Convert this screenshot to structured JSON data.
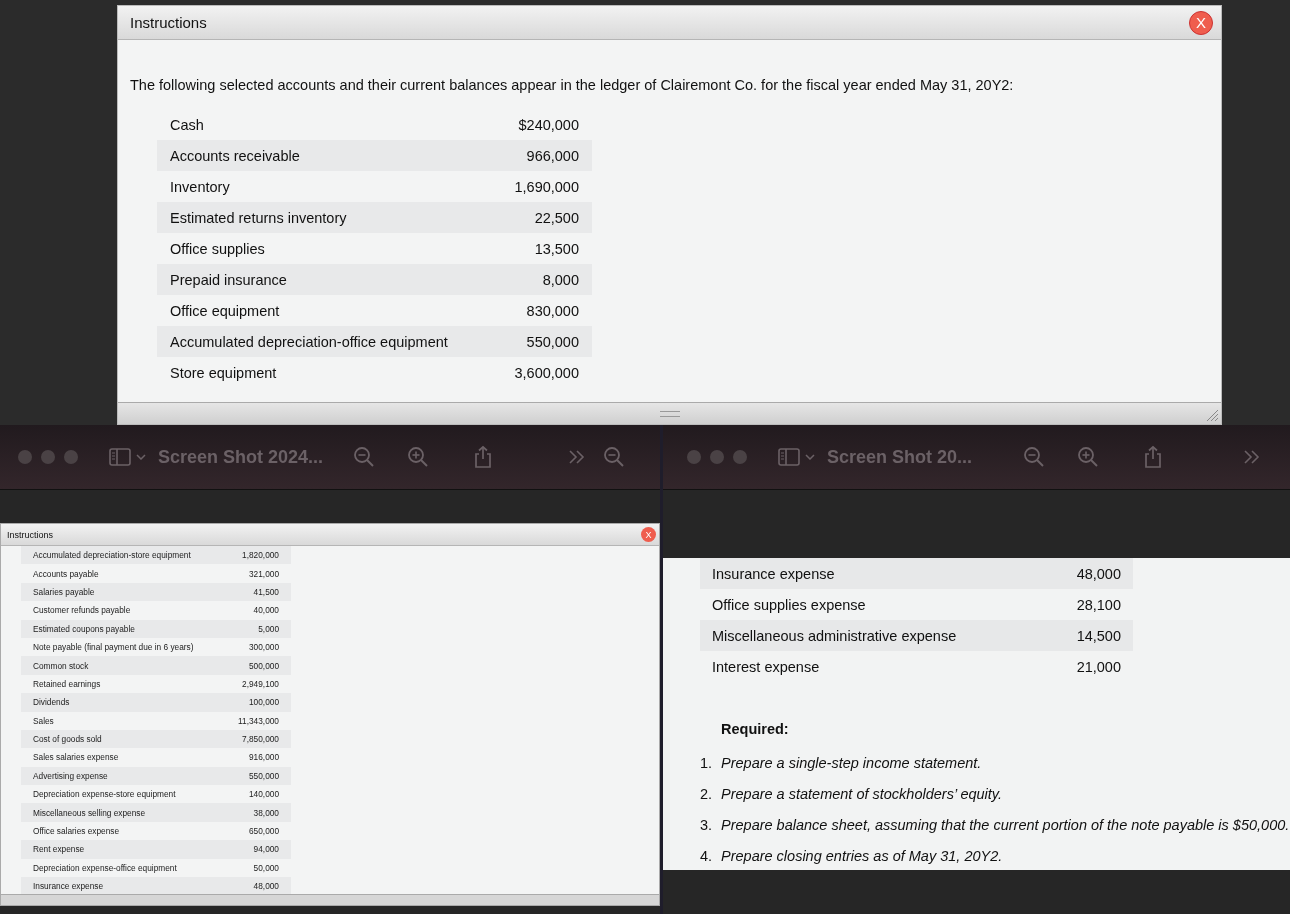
{
  "dialog": {
    "title": "Instructions",
    "close": "X",
    "intro": "The following selected accounts and their current balances appear in the ledger of Clairemont Co. for the fiscal year ended May 31, 20Y2:",
    "accounts": [
      {
        "name": "Cash",
        "amount": "$240,000"
      },
      {
        "name": "Accounts receivable",
        "amount": "966,000"
      },
      {
        "name": "Inventory",
        "amount": "1,690,000"
      },
      {
        "name": "Estimated returns inventory",
        "amount": "22,500"
      },
      {
        "name": "Office supplies",
        "amount": "13,500"
      },
      {
        "name": "Prepaid insurance",
        "amount": "8,000"
      },
      {
        "name": "Office equipment",
        "amount": "830,000"
      },
      {
        "name": "Accumulated depreciation-office equipment",
        "amount": "550,000"
      },
      {
        "name": "Store equipment",
        "amount": "3,600,000"
      }
    ]
  },
  "viewer_windows": [
    {
      "title": "Screen Shot 2024...",
      "dialog": {
        "title": "Instructions",
        "close": "X",
        "accounts": [
          {
            "name": "Accumulated depreciation-store equipment",
            "amount": "1,820,000"
          },
          {
            "name": "Accounts payable",
            "amount": "321,000"
          },
          {
            "name": "Salaries payable",
            "amount": "41,500"
          },
          {
            "name": "Customer refunds payable",
            "amount": "40,000"
          },
          {
            "name": "Estimated coupons payable",
            "amount": "5,000"
          },
          {
            "name": "Note payable (final payment due in 6 years)",
            "amount": "300,000"
          },
          {
            "name": "Common stock",
            "amount": "500,000"
          },
          {
            "name": "Retained earnings",
            "amount": "2,949,100"
          },
          {
            "name": "Dividends",
            "amount": "100,000"
          },
          {
            "name": "Sales",
            "amount": "11,343,000"
          },
          {
            "name": "Cost of goods sold",
            "amount": "7,850,000"
          },
          {
            "name": "Sales salaries expense",
            "amount": "916,000"
          },
          {
            "name": "Advertising expense",
            "amount": "550,000"
          },
          {
            "name": "Depreciation expense-store equipment",
            "amount": "140,000"
          },
          {
            "name": "Miscellaneous selling expense",
            "amount": "38,000"
          },
          {
            "name": "Office salaries expense",
            "amount": "650,000"
          },
          {
            "name": "Rent expense",
            "amount": "94,000"
          },
          {
            "name": "Depreciation expense-office equipment",
            "amount": "50,000"
          },
          {
            "name": "Insurance expense",
            "amount": "48,000"
          }
        ]
      }
    },
    {
      "title": "Screen Shot 20...",
      "accounts": [
        {
          "name": "Insurance expense",
          "amount": "48,000"
        },
        {
          "name": "Office supplies expense",
          "amount": "28,100"
        },
        {
          "name": "Miscellaneous administrative expense",
          "amount": "14,500"
        },
        {
          "name": "Interest expense",
          "amount": "21,000"
        }
      ],
      "required": {
        "heading": "Required:",
        "items": [
          {
            "number": "1.",
            "text": "Prepare a single-step income statement."
          },
          {
            "number": "2.",
            "text": "Prepare a statement of stockholders’ equity."
          },
          {
            "number": "3.",
            "text": "Prepare balance sheet, assuming that the current portion of the note payable is $50,000."
          },
          {
            "number": "4.",
            "text": "Prepare closing entries as of May 31, 20Y2."
          }
        ]
      }
    }
  ]
}
